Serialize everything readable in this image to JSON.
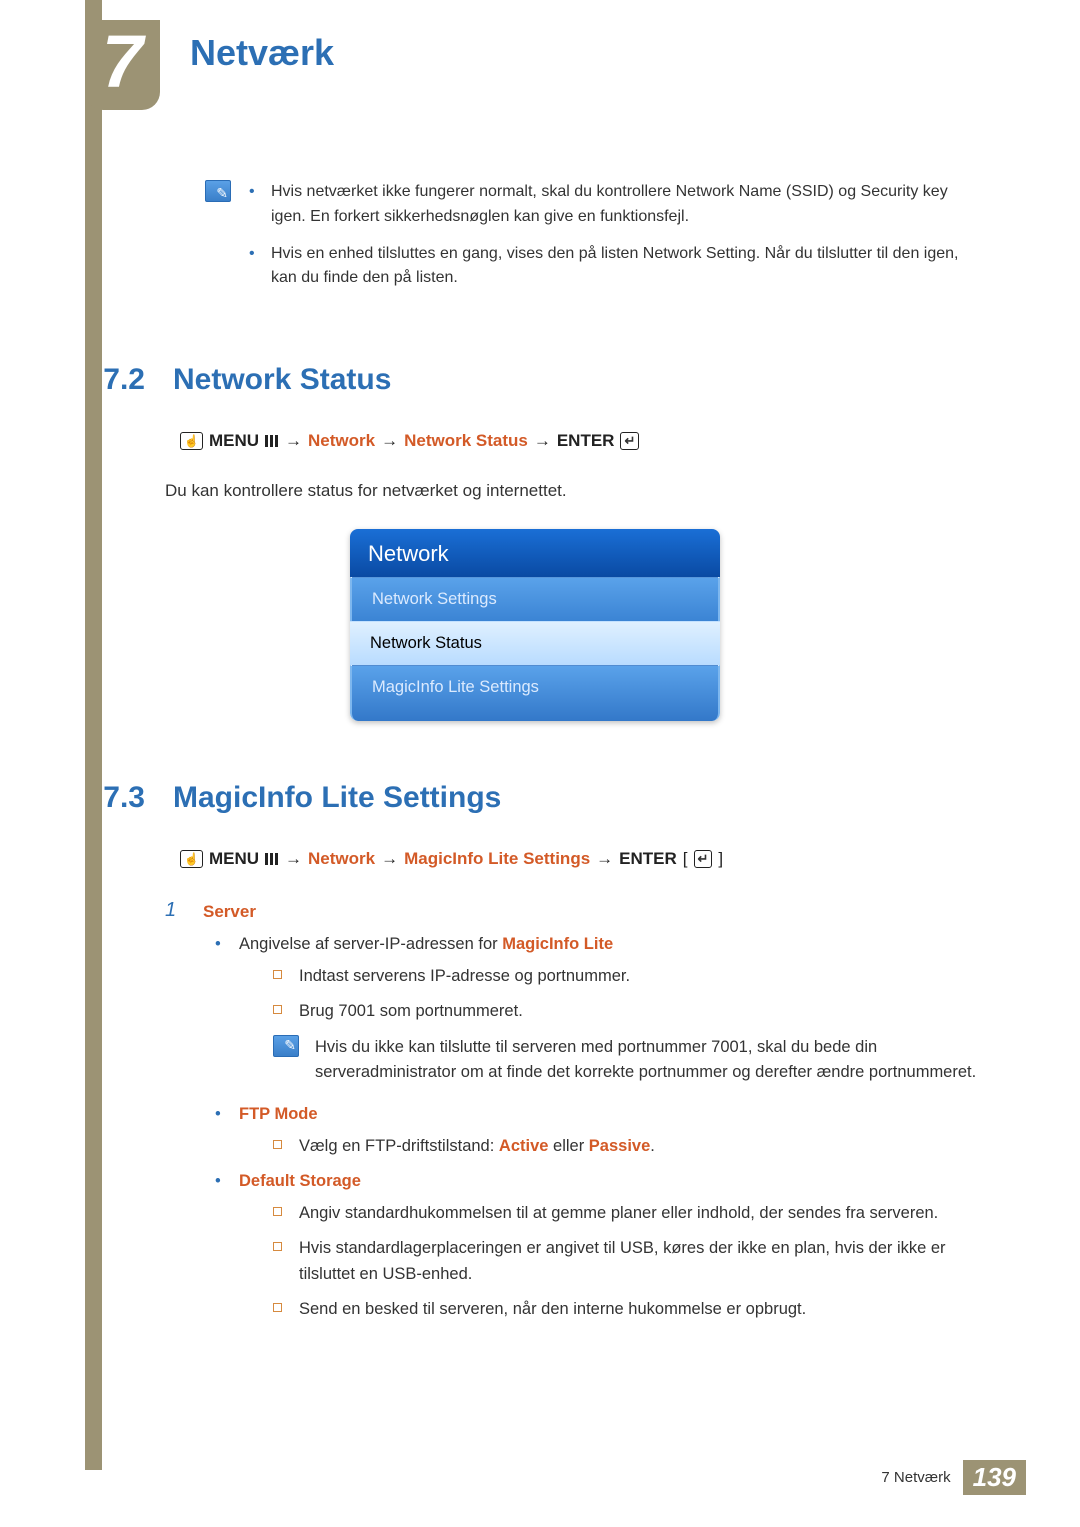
{
  "chapter": {
    "number": "7",
    "title": "Netværk"
  },
  "note_top": {
    "items": [
      "Hvis netværket ikke fungerer normalt, skal du kontrollere Network Name (SSID) og Security key igen. En forkert sikkerhedsnøglen kan give en funktionsfejl.",
      "Hvis en enhed tilsluttes en gang, vises den på listen Network Setting. Når du tilslutter til den igen, kan du finde den på listen."
    ]
  },
  "sec72": {
    "num": "7.2",
    "title": "Network Status",
    "nav": {
      "menu": "MENU",
      "n1": "Network",
      "n2": "Network Status",
      "enter": "ENTER"
    },
    "body": "Du kan kontrollere status for netværket og internettet.",
    "panel": {
      "header": "Network",
      "items": [
        "Network Settings",
        "Network Status",
        "MagicInfo Lite Settings"
      ]
    }
  },
  "sec73": {
    "num": "7.3",
    "title": "MagicInfo Lite Settings",
    "nav": {
      "menu": "MENU",
      "n1": "Network",
      "n2": "MagicInfo Lite Settings",
      "enter": "ENTER"
    },
    "step1": {
      "num": "1",
      "label": "Server"
    },
    "l2a_pre": "Angivelse af server-IP-adressen for ",
    "l2a_em": "MagicInfo Lite",
    "l3a": "Indtast serverens IP-adresse og portnummer.",
    "l3b": "Brug 7001 som portnummeret.",
    "note": "Hvis du ikke kan tilslutte til serveren med portnummer 7001, skal du bede din serveradministrator om at finde det korrekte portnummer og derefter ændre portnummeret.",
    "l2b": "FTP Mode",
    "l3c_pre": "Vælg en FTP-driftstilstand: ",
    "l3c_a": "Active",
    "l3c_mid": " eller ",
    "l3c_b": "Passive",
    "l3c_post": ".",
    "l2c": "Default Storage",
    "l3d": "Angiv standardhukommelsen til at gemme planer eller indhold, der sendes fra serveren.",
    "l3e": "Hvis standardlagerplaceringen er angivet til USB, køres der ikke en plan, hvis der ikke er tilsluttet en USB-enhed.",
    "l3f": "Send en besked til serveren, når den interne hukommelse er opbrugt."
  },
  "footer": {
    "text": "7 Netværk",
    "page": "139"
  }
}
